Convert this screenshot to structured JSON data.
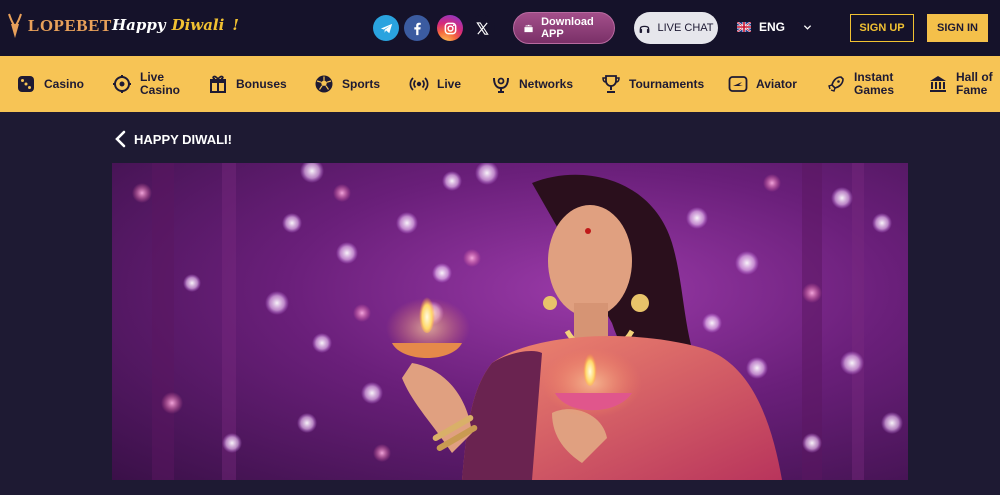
{
  "header": {
    "logo_text": "LOPEBET",
    "diwali_greeting": [
      "Happy",
      "Diwali",
      "!"
    ],
    "download_label": "Download APP",
    "livechat_label": "LIVE CHAT",
    "language": "ENG",
    "signup_label": "SIGN UP",
    "signin_label": "SIGN IN"
  },
  "nav": {
    "items": [
      {
        "label": "Casino",
        "icon": "dice-icon"
      },
      {
        "label": "Live\nCasino",
        "icon": "live-casino-icon"
      },
      {
        "label": "Bonuses",
        "icon": "gift-icon"
      },
      {
        "label": "Sports",
        "icon": "soccer-ball-icon"
      },
      {
        "label": "Live",
        "icon": "broadcast-icon"
      },
      {
        "label": "Networks",
        "icon": "networks-icon"
      },
      {
        "label": "Tournaments",
        "icon": "trophy-icon"
      },
      {
        "label": "Aviator",
        "icon": "aviator-icon"
      },
      {
        "label": "Instant\nGames",
        "icon": "rocket-icon"
      },
      {
        "label": "Hall of\nFame",
        "icon": "hall-icon"
      }
    ]
  },
  "page": {
    "title": "HAPPY DIWALI!"
  },
  "colors": {
    "header_bg": "#15122a",
    "nav_bg": "#f7c455",
    "page_bg": "#1e1a33",
    "accent": "#f1c132"
  }
}
